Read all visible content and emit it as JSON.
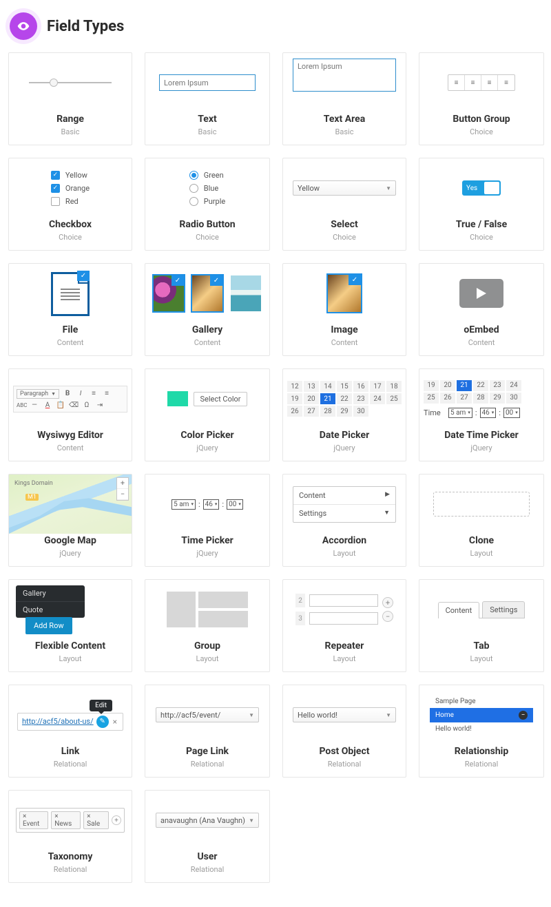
{
  "page_title": "Field Types",
  "categories": {
    "basic": "Basic",
    "choice": "Choice",
    "content": "Content",
    "jquery": "jQuery",
    "layout": "Layout",
    "relational": "Relational"
  },
  "cards": {
    "range": {
      "title": "Range",
      "cat": "basic"
    },
    "text": {
      "title": "Text",
      "cat": "basic",
      "placeholder": "Lorem Ipsum"
    },
    "textarea": {
      "title": "Text Area",
      "cat": "basic",
      "placeholder": "Lorem Ipsum"
    },
    "button_group": {
      "title": "Button Group",
      "cat": "choice"
    },
    "checkbox": {
      "title": "Checkbox",
      "cat": "choice",
      "options": [
        {
          "label": "Yellow",
          "checked": true
        },
        {
          "label": "Orange",
          "checked": true
        },
        {
          "label": "Red",
          "checked": false
        }
      ]
    },
    "radio": {
      "title": "Radio Button",
      "cat": "choice",
      "options": [
        {
          "label": "Green",
          "checked": true
        },
        {
          "label": "Blue",
          "checked": false
        },
        {
          "label": "Purple",
          "checked": false
        }
      ]
    },
    "select": {
      "title": "Select",
      "cat": "choice",
      "value": "Yellow"
    },
    "true_false": {
      "title": "True / False",
      "cat": "choice",
      "label": "Yes"
    },
    "file": {
      "title": "File",
      "cat": "content"
    },
    "gallery": {
      "title": "Gallery",
      "cat": "content"
    },
    "image": {
      "title": "Image",
      "cat": "content"
    },
    "oembed": {
      "title": "oEmbed",
      "cat": "content"
    },
    "wysiwyg": {
      "title": "Wysiwyg Editor",
      "cat": "content",
      "style_label": "Paragraph"
    },
    "color_picker": {
      "title": "Color Picker",
      "cat": "jquery",
      "button": "Select Color"
    },
    "date_picker": {
      "title": "Date Picker",
      "cat": "jquery",
      "days": [
        12,
        13,
        14,
        15,
        16,
        17,
        18,
        19,
        20,
        21,
        22,
        23,
        24,
        25,
        26,
        27,
        28,
        29,
        30
      ],
      "selected_day": 21
    },
    "date_time_picker": {
      "title": "Date Time Picker",
      "cat": "jquery",
      "days": [
        19,
        20,
        21,
        22,
        23,
        24,
        25,
        26,
        27,
        28,
        29,
        30
      ],
      "selected_day": 21,
      "time_label": "Time",
      "hour": "5 am",
      "minute": "46",
      "second": "00"
    },
    "google_map": {
      "title": "Google Map",
      "cat": "jquery",
      "labels": {
        "kings": "Kings Domain",
        "m1": "M1"
      }
    },
    "time_picker": {
      "title": "Time Picker",
      "cat": "jquery",
      "hour": "5 am",
      "minute": "46",
      "second": "00"
    },
    "accordion": {
      "title": "Accordion",
      "cat": "layout",
      "rows": [
        "Content",
        "Settings"
      ]
    },
    "clone": {
      "title": "Clone",
      "cat": "layout"
    },
    "flexible": {
      "title": "Flexible Content",
      "cat": "layout",
      "menu": [
        "Gallery",
        "Quote"
      ],
      "button": "Add Row"
    },
    "group": {
      "title": "Group",
      "cat": "layout"
    },
    "repeater": {
      "title": "Repeater",
      "cat": "layout",
      "rows": [
        "2",
        "3"
      ]
    },
    "tab": {
      "title": "Tab",
      "cat": "layout",
      "tabs": [
        "Content",
        "Settings"
      ],
      "active": 0
    },
    "link": {
      "title": "Link",
      "cat": "relational",
      "tooltip": "Edit",
      "url": "http://acf5/about-us/"
    },
    "page_link": {
      "title": "Page Link",
      "cat": "relational",
      "value": "http://acf5/event/"
    },
    "post_object": {
      "title": "Post Object",
      "cat": "relational",
      "value": "Hello world!"
    },
    "relationship": {
      "title": "Relationship",
      "cat": "relational",
      "rows": [
        "Sample Page",
        "Home",
        "Hello world!"
      ],
      "active": 1
    },
    "taxonomy": {
      "title": "Taxonomy",
      "cat": "relational",
      "tags": [
        "Event",
        "News",
        "Sale"
      ]
    },
    "user": {
      "title": "User",
      "cat": "relational",
      "value": "anavaughn (Ana Vaughn)"
    }
  }
}
